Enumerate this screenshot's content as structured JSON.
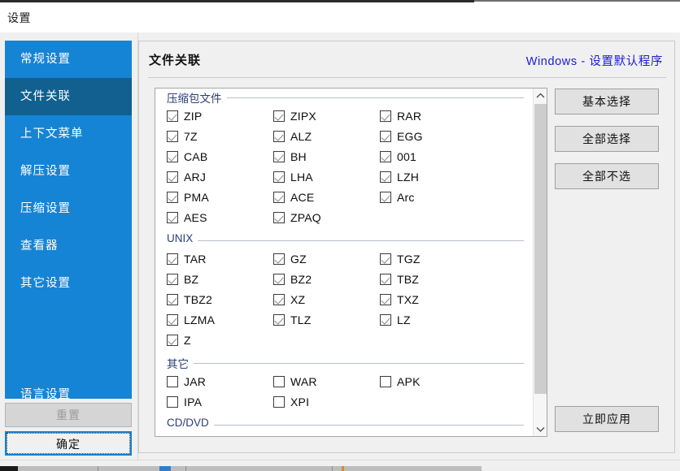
{
  "window": {
    "title": "设置"
  },
  "sidebar": {
    "items": [
      {
        "label": "常规设置",
        "active": false
      },
      {
        "label": "文件关联",
        "active": true
      },
      {
        "label": "上下文菜单",
        "active": false
      },
      {
        "label": "解压设置",
        "active": false
      },
      {
        "label": "压缩设置",
        "active": false
      },
      {
        "label": "查看器",
        "active": false
      },
      {
        "label": "其它设置",
        "active": false
      }
    ],
    "bottom_item": {
      "label": "语言设置",
      "active": false
    },
    "reset_button": "重置",
    "ok_button": "确定"
  },
  "main": {
    "heading": "文件关联",
    "default_programs_link": "Windows - 设置默认程序",
    "buttons": {
      "basic_select": "基本选择",
      "select_all": "全部选择",
      "select_none": "全部不选",
      "apply_now": "立即应用"
    },
    "groups": [
      {
        "name": "压缩包文件",
        "rows": [
          [
            {
              "label": "ZIP",
              "checked": true
            },
            {
              "label": "ZIPX",
              "checked": true
            },
            {
              "label": "RAR",
              "checked": true
            }
          ],
          [
            {
              "label": "7Z",
              "checked": true
            },
            {
              "label": "ALZ",
              "checked": true
            },
            {
              "label": "EGG",
              "checked": true
            }
          ],
          [
            {
              "label": "CAB",
              "checked": true
            },
            {
              "label": "BH",
              "checked": true
            },
            {
              "label": "001",
              "checked": true
            }
          ],
          [
            {
              "label": "ARJ",
              "checked": true
            },
            {
              "label": "LHA",
              "checked": true
            },
            {
              "label": "LZH",
              "checked": true
            }
          ],
          [
            {
              "label": "PMA",
              "checked": true
            },
            {
              "label": "ACE",
              "checked": true
            },
            {
              "label": "Arc",
              "checked": true
            }
          ],
          [
            {
              "label": "AES",
              "checked": true
            },
            {
              "label": "ZPAQ",
              "checked": true
            }
          ]
        ]
      },
      {
        "name": "UNIX",
        "rows": [
          [
            {
              "label": "TAR",
              "checked": true
            },
            {
              "label": "GZ",
              "checked": true
            },
            {
              "label": "TGZ",
              "checked": true
            }
          ],
          [
            {
              "label": "BZ",
              "checked": true
            },
            {
              "label": "BZ2",
              "checked": true
            },
            {
              "label": "TBZ",
              "checked": true
            }
          ],
          [
            {
              "label": "TBZ2",
              "checked": true
            },
            {
              "label": "XZ",
              "checked": true
            },
            {
              "label": "TXZ",
              "checked": true
            }
          ],
          [
            {
              "label": "LZMA",
              "checked": true
            },
            {
              "label": "TLZ",
              "checked": true
            },
            {
              "label": "LZ",
              "checked": true
            }
          ],
          [
            {
              "label": "Z",
              "checked": true
            }
          ]
        ]
      },
      {
        "name": "其它",
        "rows": [
          [
            {
              "label": "JAR",
              "checked": false
            },
            {
              "label": "WAR",
              "checked": false
            },
            {
              "label": "APK",
              "checked": false
            }
          ],
          [
            {
              "label": "IPA",
              "checked": false
            },
            {
              "label": "XPI",
              "checked": false
            }
          ]
        ]
      },
      {
        "name": "CD/DVD",
        "rows": []
      }
    ]
  },
  "colors": {
    "sidebar_blue": "#1684d5",
    "sidebar_active_blue": "#11608f",
    "link_blue": "#1b1bd4",
    "group_label": "#2b3f75",
    "focus_border": "#1482d6"
  }
}
